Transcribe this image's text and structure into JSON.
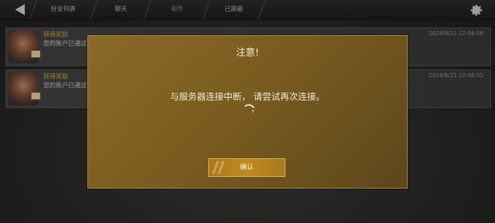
{
  "tabs": [
    {
      "label": "好友列表"
    },
    {
      "label": "聊天"
    },
    {
      "label": "邮件"
    },
    {
      "label": "已屏蔽"
    }
  ],
  "mails": [
    {
      "title": "获得奖励",
      "text": "您的账户已通过",
      "time": "2024/8/21 22:08:58"
    },
    {
      "title": "获得奖励",
      "text": "您的账户已通过",
      "time": "2024/8/21 22:08:55"
    }
  ],
  "dialog": {
    "title": "注意!",
    "message": "与服务器连接中断， 请尝试再次连接。",
    "confirm_label": "确认"
  },
  "colors": {
    "dialog_bg": "#7a5c20",
    "button_bg": "#c08a24",
    "mail_title": "#c9a84c"
  },
  "icons": {
    "back": "back-arrow-icon",
    "settings": "gear-icon",
    "mail": "envelope-icon",
    "loading": "spinner-icon"
  }
}
